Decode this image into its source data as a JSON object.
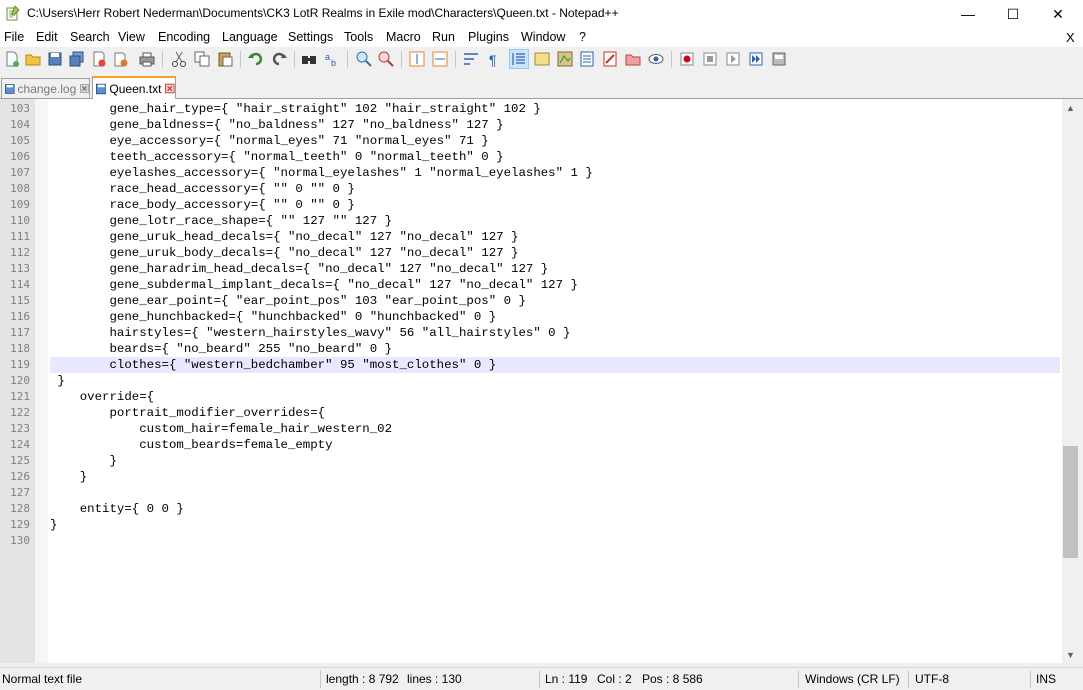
{
  "window": {
    "title": "C:\\Users\\Herr Robert Nederman\\Documents\\CK3 LotR Realms in Exile mod\\Characters\\Queen.txt - Notepad++",
    "minimize": "—",
    "maximize": "☐",
    "close": "✕"
  },
  "menu": {
    "items": [
      "File",
      "Edit",
      "Search",
      "View",
      "Encoding",
      "Language",
      "Settings",
      "Tools",
      "Macro",
      "Run",
      "Plugins",
      "Window",
      "?"
    ],
    "close": "X"
  },
  "tabs": [
    {
      "label": "change.log"
    },
    {
      "label": "Queen.txt"
    }
  ],
  "editor": {
    "current_line": 119,
    "lines": [
      {
        "num": "103",
        "text": "        gene_hair_type={ \"hair_straight\" 102 \"hair_straight\" 102 }"
      },
      {
        "num": "104",
        "text": "        gene_baldness={ \"no_baldness\" 127 \"no_baldness\" 127 }"
      },
      {
        "num": "105",
        "text": "        eye_accessory={ \"normal_eyes\" 71 \"normal_eyes\" 71 }"
      },
      {
        "num": "106",
        "text": "        teeth_accessory={ \"normal_teeth\" 0 \"normal_teeth\" 0 }"
      },
      {
        "num": "107",
        "text": "        eyelashes_accessory={ \"normal_eyelashes\" 1 \"normal_eyelashes\" 1 }"
      },
      {
        "num": "108",
        "text": "        race_head_accessory={ \"\" 0 \"\" 0 }"
      },
      {
        "num": "109",
        "text": "        race_body_accessory={ \"\" 0 \"\" 0 }"
      },
      {
        "num": "110",
        "text": "        gene_lotr_race_shape={ \"\" 127 \"\" 127 }"
      },
      {
        "num": "111",
        "text": "        gene_uruk_head_decals={ \"no_decal\" 127 \"no_decal\" 127 }"
      },
      {
        "num": "112",
        "text": "        gene_uruk_body_decals={ \"no_decal\" 127 \"no_decal\" 127 }"
      },
      {
        "num": "113",
        "text": "        gene_haradrim_head_decals={ \"no_decal\" 127 \"no_decal\" 127 }"
      },
      {
        "num": "114",
        "text": "        gene_subdermal_implant_decals={ \"no_decal\" 127 \"no_decal\" 127 }"
      },
      {
        "num": "115",
        "text": "        gene_ear_point={ \"ear_point_pos\" 103 \"ear_point_pos\" 0 }"
      },
      {
        "num": "116",
        "text": "        gene_hunchbacked={ \"hunchbacked\" 0 \"hunchbacked\" 0 }"
      },
      {
        "num": "117",
        "text": "        hairstyles={ \"western_hairstyles_wavy\" 56 \"all_hairstyles\" 0 }"
      },
      {
        "num": "118",
        "text": "        beards={ \"no_beard\" 255 \"no_beard\" 0 }"
      },
      {
        "num": "119",
        "text": "        clothes={ \"western_bedchamber\" 95 \"most_clothes\" 0 }"
      },
      {
        "num": "120",
        "text": " }"
      },
      {
        "num": "121",
        "text": "    override={"
      },
      {
        "num": "122",
        "text": "        portrait_modifier_overrides={"
      },
      {
        "num": "123",
        "text": "            custom_hair=female_hair_western_02"
      },
      {
        "num": "124",
        "text": "            custom_beards=female_empty"
      },
      {
        "num": "125",
        "text": "        }"
      },
      {
        "num": "126",
        "text": "    }"
      },
      {
        "num": "127",
        "text": ""
      },
      {
        "num": "128",
        "text": "    entity={ 0 0 }"
      },
      {
        "num": "129",
        "text": "}"
      },
      {
        "num": "130",
        "text": ""
      }
    ]
  },
  "status": {
    "file_type": "Normal text file",
    "length": "length : 8 792",
    "lines": "lines : 130",
    "ln": "Ln : 119",
    "col": "Col : 2",
    "pos": "Pos : 8 586",
    "eol": "Windows (CR LF)",
    "encoding": "UTF-8",
    "mode": "INS"
  },
  "colors": {
    "tab_accent": "#fa9e2c",
    "current_line": "#e8e8ff",
    "gutter": "#e4e4e4"
  },
  "toolbar_icons": [
    "new-file-icon",
    "open-file-icon",
    "save-icon",
    "save-all-icon",
    "close-icon",
    "close-all-icon",
    "print-icon",
    "cut-icon",
    "copy-icon",
    "paste-icon",
    "undo-icon",
    "redo-icon",
    "find-icon",
    "replace-icon",
    "zoom-in-icon",
    "zoom-out-icon",
    "sync-vertical-icon",
    "sync-horizontal-icon",
    "word-wrap-icon",
    "show-all-chars-icon",
    "indent-guide-icon",
    "udl-icon",
    "doc-map-icon",
    "function-list-icon",
    "folder-workspace-icon",
    "monitoring-icon",
    "record-macro-icon",
    "stop-record-icon",
    "play-macro-icon",
    "run-macro-multiple-icon",
    "save-macro-icon"
  ]
}
